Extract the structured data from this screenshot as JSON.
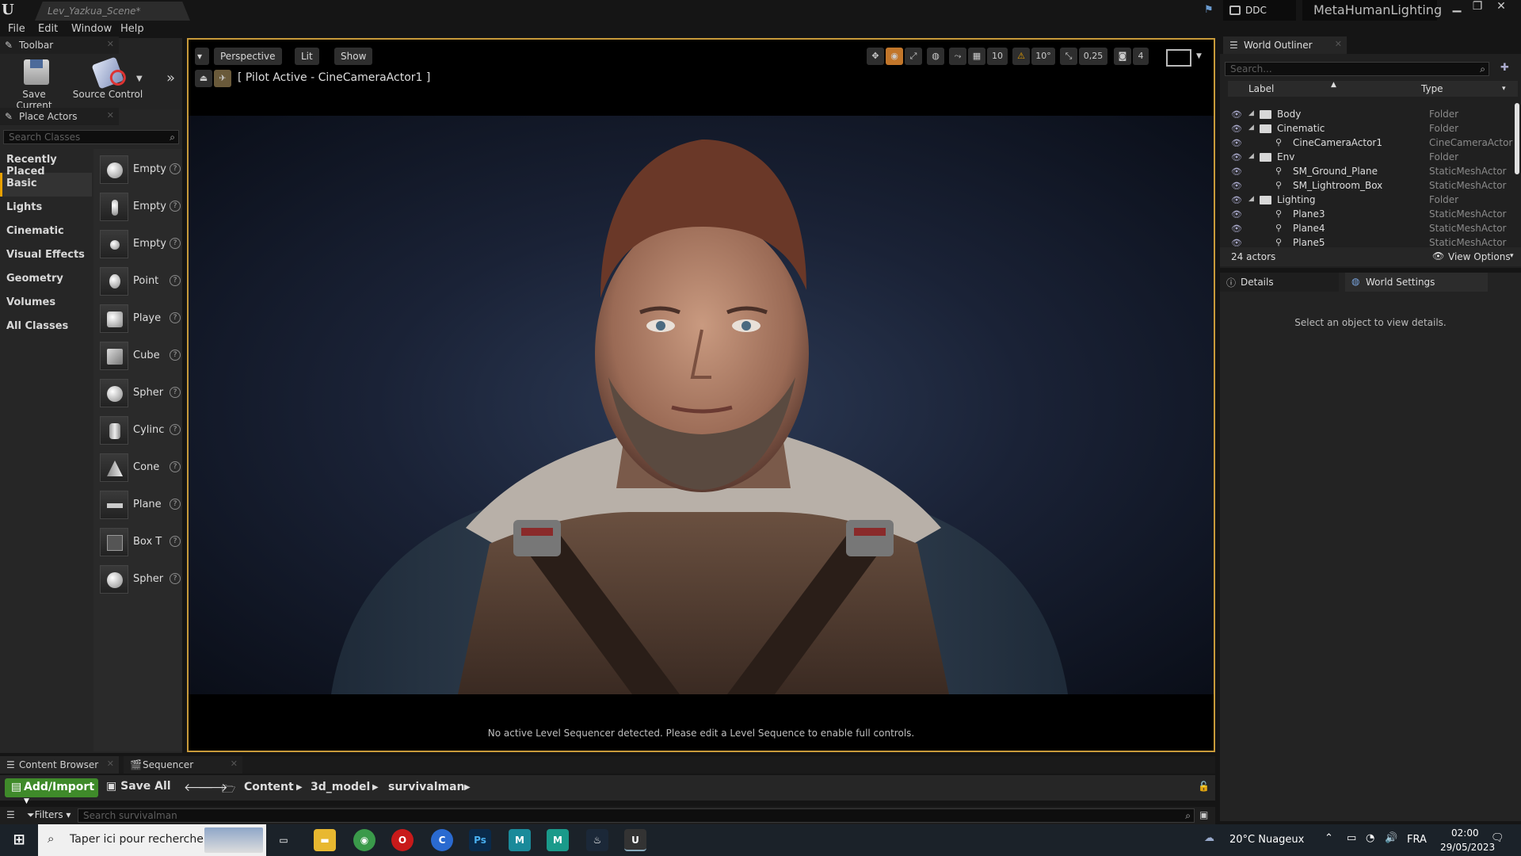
{
  "window": {
    "doc_tab": "Lev_Yazkua_Scene*",
    "ddc_label": "DDC",
    "project_name": "MetaHumanLighting"
  },
  "menu": [
    "File",
    "Edit",
    "Window",
    "Help"
  ],
  "toolbar": {
    "tab_label": "Toolbar",
    "save_current": "Save Current",
    "source_control": "Source Control"
  },
  "place_actors": {
    "tab_label": "Place Actors",
    "search_placeholder": "Search Classes",
    "categories": [
      "Recently Placed",
      "Basic",
      "Lights",
      "Cinematic",
      "Visual Effects",
      "Geometry",
      "Volumes",
      "All Classes"
    ],
    "active_category": "Basic",
    "items": [
      "Empty",
      "Empty",
      "Empty",
      "Point",
      "Playe",
      "Cube",
      "Spher",
      "Cylinc",
      "Cone",
      "Plane",
      "Box T",
      "Spher"
    ]
  },
  "viewport": {
    "perspective": "Perspective",
    "lit": "Lit",
    "show": "Show",
    "pilot_text": "[ Pilot Active - CineCameraActor1 ]",
    "grid_snap": "10",
    "rot_snap": "10°",
    "scale_snap": "0,25",
    "cam_speed": "4",
    "bottom_message": "No active Level Sequencer detected. Please edit a Level Sequence to enable full controls."
  },
  "outliner": {
    "tab_label": "World Outliner",
    "search_placeholder": "Search...",
    "col_label": "Label",
    "col_type": "Type",
    "rows": [
      {
        "label": "Body",
        "type": "Folder",
        "indent": 0,
        "folder": true
      },
      {
        "label": "Cinematic",
        "type": "Folder",
        "indent": 0,
        "folder": true
      },
      {
        "label": "CineCameraActor1",
        "type": "CineCameraActor",
        "indent": 1,
        "folder": false
      },
      {
        "label": "Env",
        "type": "Folder",
        "indent": 0,
        "folder": true
      },
      {
        "label": "SM_Ground_Plane",
        "type": "StaticMeshActor",
        "indent": 1,
        "folder": false
      },
      {
        "label": "SM_Lightroom_Box",
        "type": "StaticMeshActor",
        "indent": 1,
        "folder": false
      },
      {
        "label": "Lighting",
        "type": "Folder",
        "indent": 0,
        "folder": true
      },
      {
        "label": "Plane3",
        "type": "StaticMeshActor",
        "indent": 1,
        "folder": false
      },
      {
        "label": "Plane4",
        "type": "StaticMeshActor",
        "indent": 1,
        "folder": false
      },
      {
        "label": "Plane5",
        "type": "StaticMeshActor",
        "indent": 1,
        "folder": false
      }
    ],
    "actor_count": "24 actors",
    "view_options": "View Options"
  },
  "details": {
    "tab_details": "Details",
    "tab_world": "World Settings",
    "empty_message": "Select an object to view details."
  },
  "content_browser": {
    "tab_cb": "Content Browser",
    "tab_seq": "Sequencer",
    "add_import": "Add/Import",
    "save_all": "Save All",
    "path": [
      "Content",
      "3d_model",
      "survivalman"
    ],
    "filters": "Filters",
    "search_placeholder": "Search survivalman"
  },
  "taskbar": {
    "search_text": "Taper ici pour rechercher",
    "weather": "20°C Nuageux",
    "lang": "FRA",
    "time": "02:00",
    "date": "29/05/2023"
  },
  "colors": {
    "accent": "#c89a3a",
    "add_import": "#3f8a2a",
    "active_category": "#e8a000"
  }
}
